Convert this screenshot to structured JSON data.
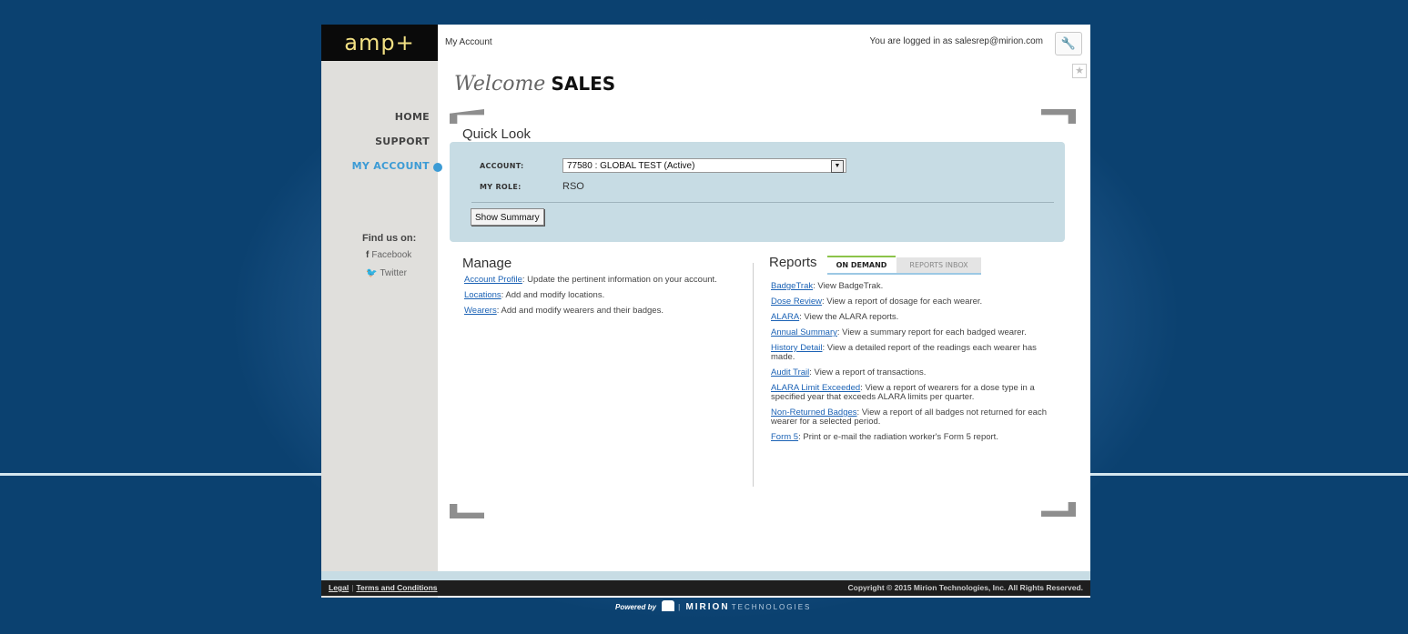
{
  "header": {
    "logo": "amp+",
    "breadcrumb": "My Account",
    "logged_in": "You are logged in as salesrep@mirion.com"
  },
  "welcome": {
    "prefix": "Welcome",
    "name": "SALES"
  },
  "nav": {
    "items": [
      {
        "label": "HOME",
        "active": false
      },
      {
        "label": "SUPPORT",
        "active": false
      },
      {
        "label": "MY ACCOUNT",
        "active": true
      }
    ],
    "find_us": "Find us on:",
    "social": [
      {
        "label": "Facebook",
        "icon": "facebook-icon"
      },
      {
        "label": "Twitter",
        "icon": "twitter-icon"
      }
    ]
  },
  "quick_look": {
    "title": "Quick Look",
    "account_label": "ACCOUNT:",
    "account_value": "77580 : GLOBAL TEST (Active)",
    "role_label": "MY ROLE:",
    "role_value": "RSO",
    "summary_button": "Show Summary"
  },
  "manage": {
    "title": "Manage",
    "items": [
      {
        "link": "Account Profile",
        "desc": ": Update the pertinent information on your account."
      },
      {
        "link": "Locations",
        "desc": ": Add and modify locations."
      },
      {
        "link": "Wearers",
        "desc": ": Add and modify wearers and their badges."
      }
    ]
  },
  "reports": {
    "title": "Reports",
    "tabs": [
      "ON DEMAND",
      "REPORTS INBOX"
    ],
    "items": [
      {
        "link": "BadgeTrak",
        "desc": ": View BadgeTrak."
      },
      {
        "link": "Dose Review",
        "desc": ": View a report of dosage for each wearer."
      },
      {
        "link": "ALARA",
        "desc": ": View the ALARA reports."
      },
      {
        "link": "Annual Summary",
        "desc": ": View a summary report for each badged wearer."
      },
      {
        "link": "History Detail",
        "desc": ": View a detailed report of the readings each wearer has made."
      },
      {
        "link": "Audit Trail",
        "desc": ": View a report of transactions."
      },
      {
        "link": "ALARA Limit Exceeded",
        "desc": ": View a report of wearers for a dose type in a specified year that exceeds ALARA limits per quarter."
      },
      {
        "link": "Non-Returned Badges",
        "desc": ": View a report of all badges not returned for each wearer for a selected period."
      },
      {
        "link": "Form 5",
        "desc": ": Print or e-mail the radiation worker's Form 5 report."
      }
    ]
  },
  "footer": {
    "legal": "Legal",
    "terms": "Terms and Conditions",
    "copyright": "Copyright © 2015 Mirion Technologies, Inc. All Rights Reserved.",
    "powered_by": "Powered by",
    "brand": "MIRION",
    "brand_suffix": "TECHNOLOGIES"
  },
  "colors": {
    "accent": "#3c9bd5",
    "background": "#0b4170",
    "quick_look_bg": "#c7dce4",
    "link": "#1b62b5"
  }
}
